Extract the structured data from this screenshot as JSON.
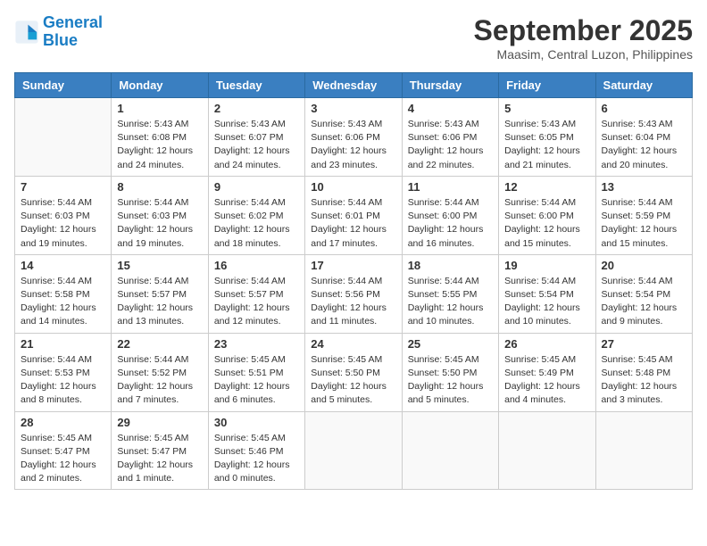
{
  "header": {
    "logo_line1": "General",
    "logo_line2": "Blue",
    "month": "September 2025",
    "location": "Maasim, Central Luzon, Philippines"
  },
  "days_of_week": [
    "Sunday",
    "Monday",
    "Tuesday",
    "Wednesday",
    "Thursday",
    "Friday",
    "Saturday"
  ],
  "weeks": [
    [
      {
        "day": "",
        "info": ""
      },
      {
        "day": "1",
        "info": "Sunrise: 5:43 AM\nSunset: 6:08 PM\nDaylight: 12 hours\nand 24 minutes."
      },
      {
        "day": "2",
        "info": "Sunrise: 5:43 AM\nSunset: 6:07 PM\nDaylight: 12 hours\nand 24 minutes."
      },
      {
        "day": "3",
        "info": "Sunrise: 5:43 AM\nSunset: 6:06 PM\nDaylight: 12 hours\nand 23 minutes."
      },
      {
        "day": "4",
        "info": "Sunrise: 5:43 AM\nSunset: 6:06 PM\nDaylight: 12 hours\nand 22 minutes."
      },
      {
        "day": "5",
        "info": "Sunrise: 5:43 AM\nSunset: 6:05 PM\nDaylight: 12 hours\nand 21 minutes."
      },
      {
        "day": "6",
        "info": "Sunrise: 5:43 AM\nSunset: 6:04 PM\nDaylight: 12 hours\nand 20 minutes."
      }
    ],
    [
      {
        "day": "7",
        "info": "Sunrise: 5:44 AM\nSunset: 6:03 PM\nDaylight: 12 hours\nand 19 minutes."
      },
      {
        "day": "8",
        "info": "Sunrise: 5:44 AM\nSunset: 6:03 PM\nDaylight: 12 hours\nand 19 minutes."
      },
      {
        "day": "9",
        "info": "Sunrise: 5:44 AM\nSunset: 6:02 PM\nDaylight: 12 hours\nand 18 minutes."
      },
      {
        "day": "10",
        "info": "Sunrise: 5:44 AM\nSunset: 6:01 PM\nDaylight: 12 hours\nand 17 minutes."
      },
      {
        "day": "11",
        "info": "Sunrise: 5:44 AM\nSunset: 6:00 PM\nDaylight: 12 hours\nand 16 minutes."
      },
      {
        "day": "12",
        "info": "Sunrise: 5:44 AM\nSunset: 6:00 PM\nDaylight: 12 hours\nand 15 minutes."
      },
      {
        "day": "13",
        "info": "Sunrise: 5:44 AM\nSunset: 5:59 PM\nDaylight: 12 hours\nand 15 minutes."
      }
    ],
    [
      {
        "day": "14",
        "info": "Sunrise: 5:44 AM\nSunset: 5:58 PM\nDaylight: 12 hours\nand 14 minutes."
      },
      {
        "day": "15",
        "info": "Sunrise: 5:44 AM\nSunset: 5:57 PM\nDaylight: 12 hours\nand 13 minutes."
      },
      {
        "day": "16",
        "info": "Sunrise: 5:44 AM\nSunset: 5:57 PM\nDaylight: 12 hours\nand 12 minutes."
      },
      {
        "day": "17",
        "info": "Sunrise: 5:44 AM\nSunset: 5:56 PM\nDaylight: 12 hours\nand 11 minutes."
      },
      {
        "day": "18",
        "info": "Sunrise: 5:44 AM\nSunset: 5:55 PM\nDaylight: 12 hours\nand 10 minutes."
      },
      {
        "day": "19",
        "info": "Sunrise: 5:44 AM\nSunset: 5:54 PM\nDaylight: 12 hours\nand 10 minutes."
      },
      {
        "day": "20",
        "info": "Sunrise: 5:44 AM\nSunset: 5:54 PM\nDaylight: 12 hours\nand 9 minutes."
      }
    ],
    [
      {
        "day": "21",
        "info": "Sunrise: 5:44 AM\nSunset: 5:53 PM\nDaylight: 12 hours\nand 8 minutes."
      },
      {
        "day": "22",
        "info": "Sunrise: 5:44 AM\nSunset: 5:52 PM\nDaylight: 12 hours\nand 7 minutes."
      },
      {
        "day": "23",
        "info": "Sunrise: 5:45 AM\nSunset: 5:51 PM\nDaylight: 12 hours\nand 6 minutes."
      },
      {
        "day": "24",
        "info": "Sunrise: 5:45 AM\nSunset: 5:50 PM\nDaylight: 12 hours\nand 5 minutes."
      },
      {
        "day": "25",
        "info": "Sunrise: 5:45 AM\nSunset: 5:50 PM\nDaylight: 12 hours\nand 5 minutes."
      },
      {
        "day": "26",
        "info": "Sunrise: 5:45 AM\nSunset: 5:49 PM\nDaylight: 12 hours\nand 4 minutes."
      },
      {
        "day": "27",
        "info": "Sunrise: 5:45 AM\nSunset: 5:48 PM\nDaylight: 12 hours\nand 3 minutes."
      }
    ],
    [
      {
        "day": "28",
        "info": "Sunrise: 5:45 AM\nSunset: 5:47 PM\nDaylight: 12 hours\nand 2 minutes."
      },
      {
        "day": "29",
        "info": "Sunrise: 5:45 AM\nSunset: 5:47 PM\nDaylight: 12 hours\nand 1 minute."
      },
      {
        "day": "30",
        "info": "Sunrise: 5:45 AM\nSunset: 5:46 PM\nDaylight: 12 hours\nand 0 minutes."
      },
      {
        "day": "",
        "info": ""
      },
      {
        "day": "",
        "info": ""
      },
      {
        "day": "",
        "info": ""
      },
      {
        "day": "",
        "info": ""
      }
    ]
  ]
}
